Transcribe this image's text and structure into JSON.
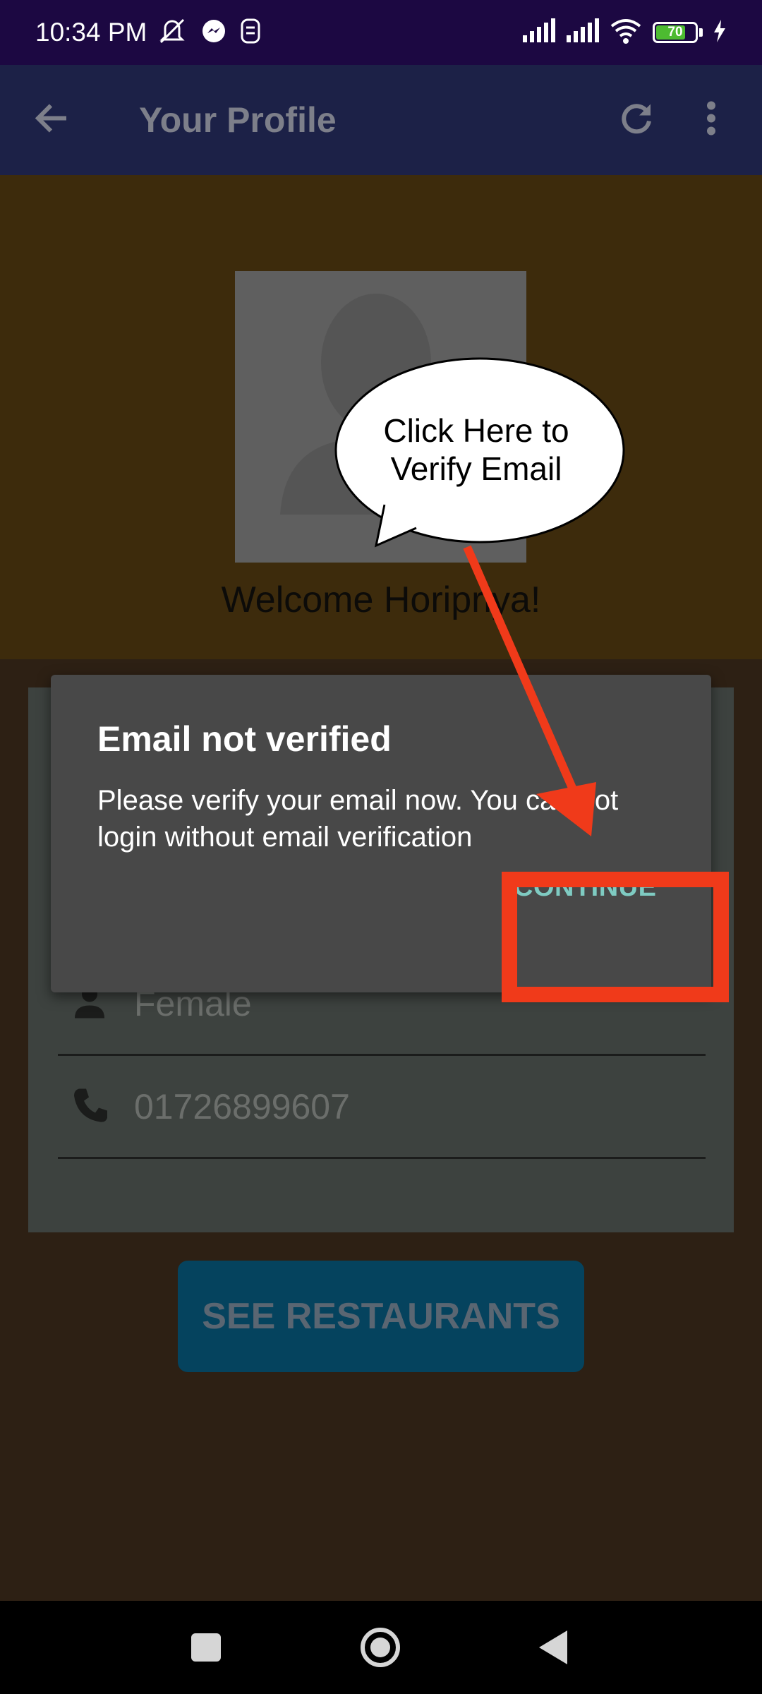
{
  "status_bar": {
    "time": "10:34 PM",
    "battery_level": "70",
    "icons_left": [
      "mute-icon",
      "messenger-icon",
      "app-notification-icon"
    ],
    "icons_right": [
      "signal-icon",
      "signal-icon",
      "wifi-icon",
      "battery-icon",
      "charging-icon"
    ]
  },
  "app_bar": {
    "title": "Your Profile",
    "icons": [
      "back-arrow-icon",
      "refresh-icon",
      "more-vert-icon"
    ]
  },
  "profile": {
    "welcome": "Welcome Horipriya!"
  },
  "form": {
    "gender": "Female",
    "phone": "01726899607",
    "see_restaurants_label": "SEE RESTAURANTS"
  },
  "dialog": {
    "title": "Email not verified",
    "message": "Please verify your email now. You can not login without email verification",
    "continue_label": "CONTINUE"
  },
  "tutorial": {
    "bubble_text_line1": "Click Here to",
    "bubble_text_line2": "Verify Email",
    "highlight_color": "#f03a1a"
  },
  "colors": {
    "status_bar": "#1c0842",
    "app_bar": "#1c2147",
    "dialog": "#484848",
    "accent_button": "#7fcbc2"
  }
}
